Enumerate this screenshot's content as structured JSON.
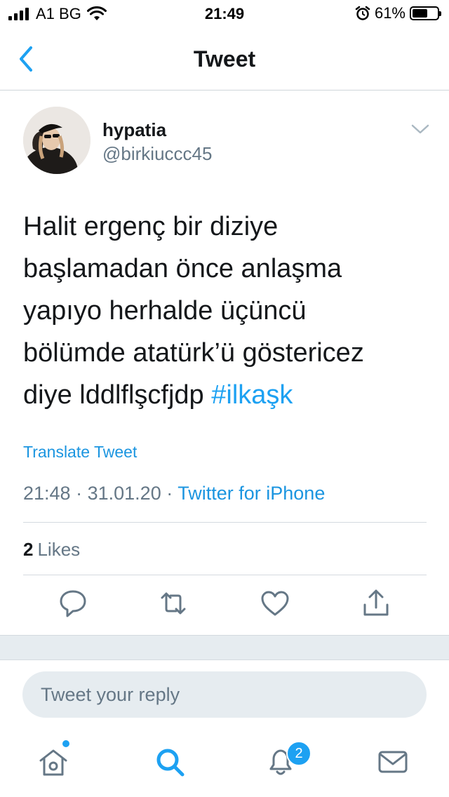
{
  "status_bar": {
    "carrier": "A1 BG",
    "time": "21:49",
    "battery_percent": "61%",
    "battery_level": 0.61,
    "icons": [
      "signal-icon",
      "wifi-icon",
      "alarm-icon",
      "battery-icon"
    ]
  },
  "nav": {
    "title": "Tweet",
    "back_icon": "chevron-left-icon"
  },
  "tweet": {
    "author": {
      "display_name": "hypatia",
      "handle": "@birkiuccc45"
    },
    "text_lines": [
      "Halit ergenç bir diziye",
      "başlamadan önce anlaşma",
      "yapıyo herhalde üçüncü",
      "bölümde atatürk’ü göstericez",
      "diye lddlflşcfjdp"
    ],
    "hashtag": "#ilkaşk",
    "translate_label": "Translate Tweet",
    "time": "21:48",
    "date": "31.01.20",
    "separator": "·",
    "source": "Twitter for iPhone",
    "likes_count": "2",
    "likes_label": "Likes"
  },
  "actions": [
    "reply-icon",
    "retweet-icon",
    "like-icon",
    "share-icon"
  ],
  "reply": {
    "placeholder": "Tweet your reply"
  },
  "tabbar": {
    "items": [
      "home-icon",
      "search-icon",
      "notifications-icon",
      "messages-icon"
    ],
    "notifications_badge": "2"
  },
  "colors": {
    "accent": "#1da1f2",
    "link": "#1b95e0",
    "text": "#14171a",
    "secondary_text": "#657786",
    "separator_band": "#e6ecf0"
  }
}
